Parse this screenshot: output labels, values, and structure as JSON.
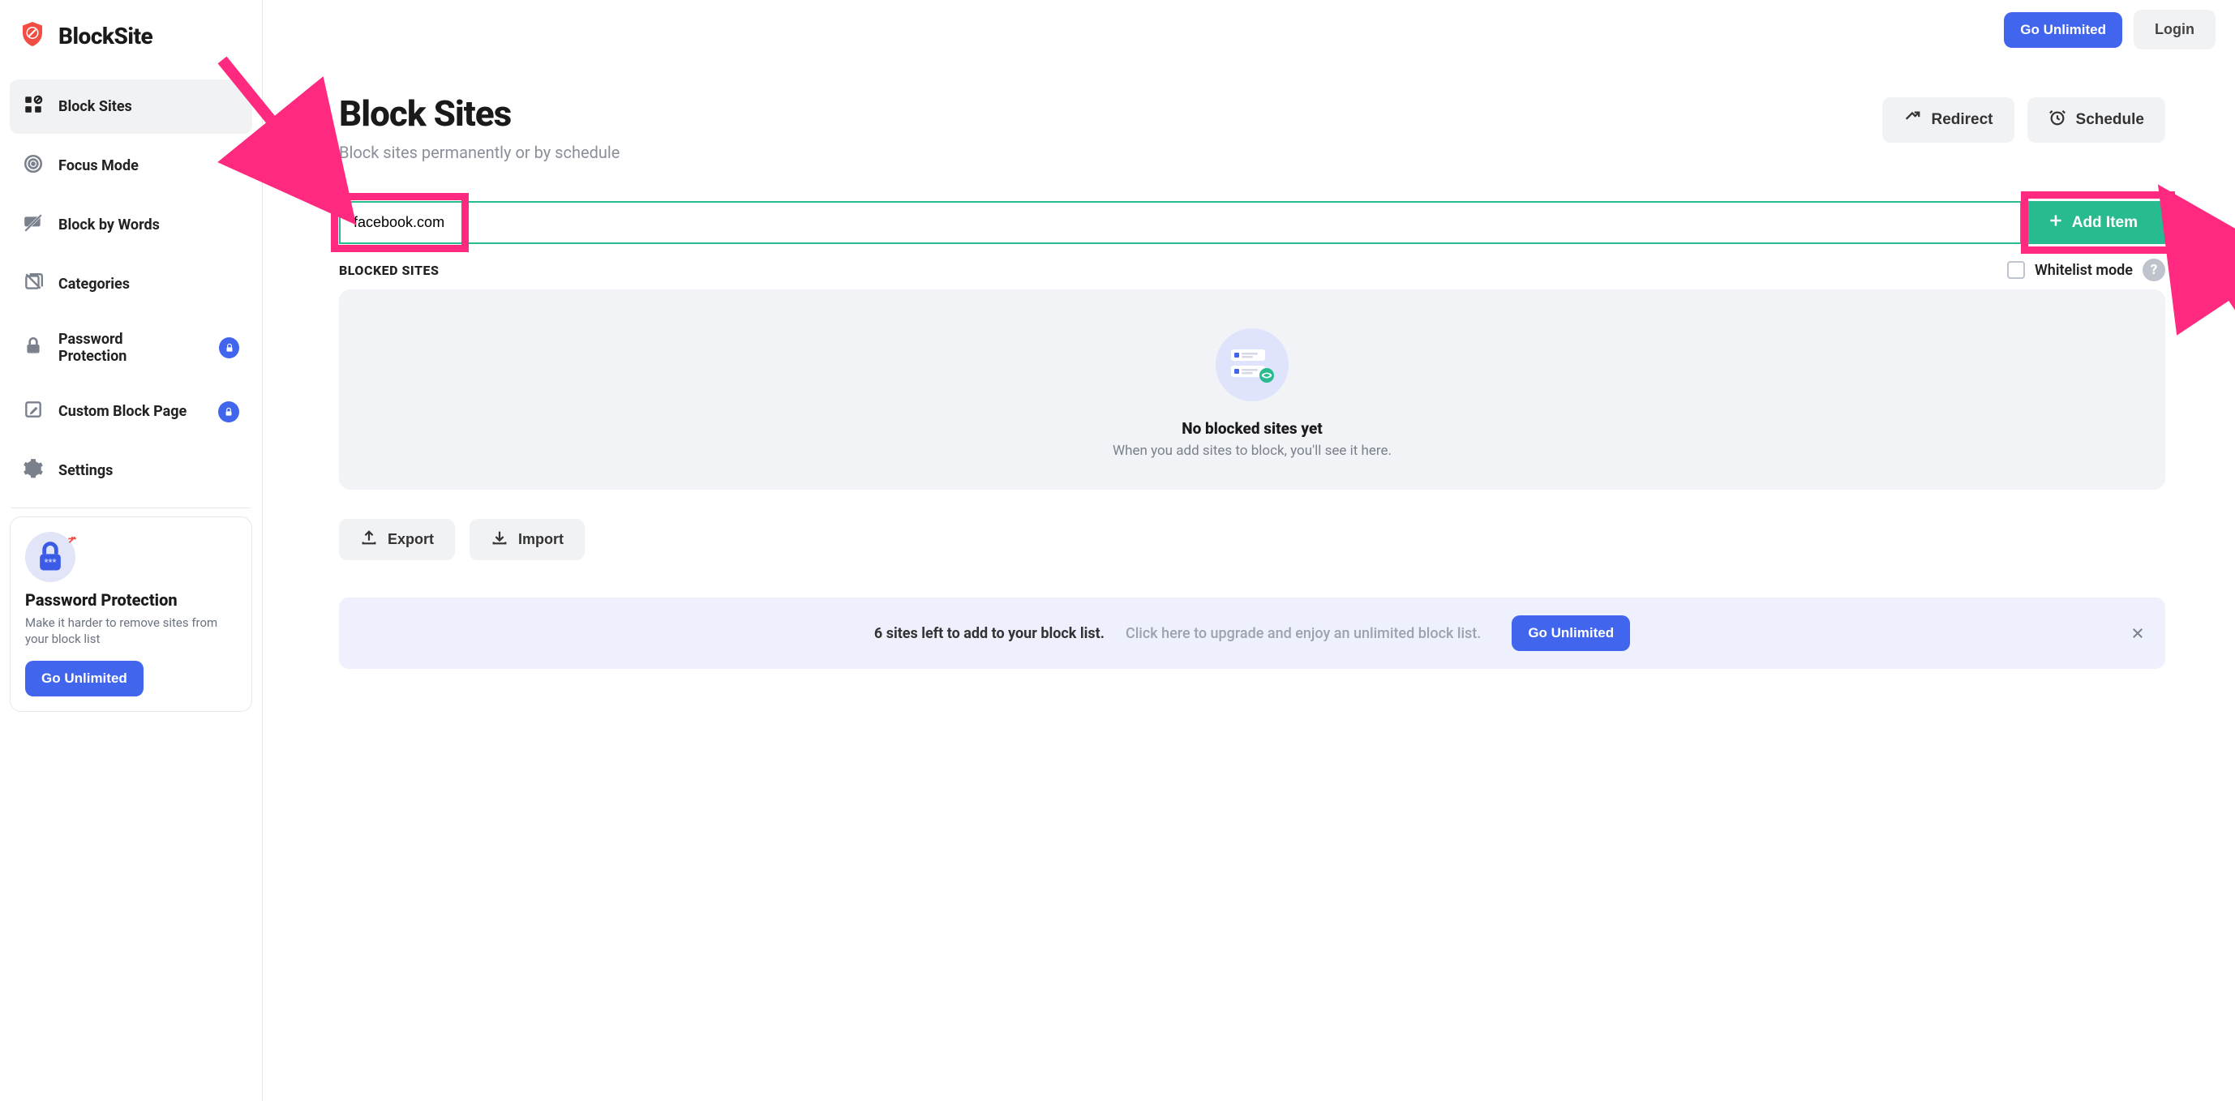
{
  "brand": {
    "name": "BlockSite"
  },
  "topbar": {
    "go_unlimited": "Go Unlimited",
    "login": "Login"
  },
  "sidebar": {
    "items": [
      {
        "label": "Block Sites",
        "icon": "grid-block-icon",
        "active": true,
        "locked": false
      },
      {
        "label": "Focus Mode",
        "icon": "target-icon",
        "active": false,
        "locked": false
      },
      {
        "label": "Block by Words",
        "icon": "chat-slash-icon",
        "active": false,
        "locked": false
      },
      {
        "label": "Categories",
        "icon": "layers-icon",
        "active": false,
        "locked": false
      },
      {
        "label": "Password Protection",
        "icon": "lock-icon",
        "active": false,
        "locked": true
      },
      {
        "label": "Custom Block Page",
        "icon": "edit-page-icon",
        "active": false,
        "locked": true
      },
      {
        "label": "Settings",
        "icon": "gear-icon",
        "active": false,
        "locked": false
      }
    ],
    "promo": {
      "title": "Password Protection",
      "desc": "Make it harder to remove sites from your block list",
      "cta": "Go Unlimited"
    }
  },
  "page": {
    "title": "Block Sites",
    "subtitle": "Block sites permanently or by schedule",
    "actions": {
      "redirect": "Redirect",
      "schedule": "Schedule"
    },
    "input": {
      "value": "facebook.com",
      "add_label": "Add Item"
    },
    "section_label": "BLOCKED SITES",
    "whitelist_label": "Whitelist mode",
    "empty": {
      "title": "No blocked sites yet",
      "subtitle": "When you add sites to block, you'll see it here."
    },
    "io": {
      "export": "Export",
      "import": "Import"
    },
    "banner": {
      "main": "6 sites left to add to your block list.",
      "sub": "Click here to upgrade and enjoy an unlimited block list.",
      "cta": "Go Unlimited"
    }
  },
  "colors": {
    "accent": "#4265ed",
    "success": "#27bb8f",
    "highlight": "#ff2a7f"
  }
}
